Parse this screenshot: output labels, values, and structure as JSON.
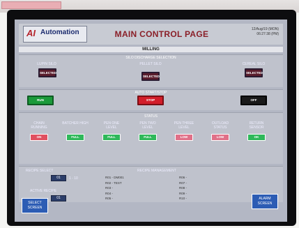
{
  "sticker_text": "",
  "header": {
    "logo_mark": "AI",
    "logo_name": "Automation",
    "logo_tag": "",
    "title": "MAIN CONTROL PAGE",
    "date": "12/Aug/19 (MON)",
    "time": "06:27:38 (PM)"
  },
  "subtitle": "MILLING",
  "silo_section": {
    "title": "SILO DISCHARGE SELECTION",
    "lupin_label": "LUPIN SILO",
    "pellet_label": "PELLET SILO",
    "cereal_label": "CEREAL SILO",
    "button_text": "SELECTED"
  },
  "auto_section": {
    "title": "AUTO START/STOP",
    "run": "RUN",
    "stop": "STOP",
    "off": "OFF"
  },
  "status_section": {
    "title": "STATUS",
    "items": [
      {
        "label": "CHAIN RUNNING",
        "value": "ON",
        "color": "#e05060"
      },
      {
        "label": "BATCHER HIGH",
        "value": "FULL",
        "color": "#2fb85a"
      },
      {
        "label": "PEN ONE LEVEL",
        "value": "FULL",
        "color": "#2fb85a"
      },
      {
        "label": "PEN TWO LEVEL",
        "value": "FULL",
        "color": "#2fb85a"
      },
      {
        "label": "PEN THREE LEVEL",
        "value": "LOW",
        "color": "#e07088"
      },
      {
        "label": "OUTLOAD STATUS",
        "value": "LOW",
        "color": "#e07088"
      },
      {
        "label": "RETURN SENSOR",
        "value": "OK",
        "color": "#2fb85a"
      }
    ]
  },
  "recipe": {
    "select_label": "RECIPE SELECT",
    "select_value": "01",
    "range": "1 - 10",
    "active_label": "ACTIVE RECIPE",
    "active_value": "01",
    "management_title": "RECIPE MANAGEMENT",
    "list_left": [
      "R01 - DM001",
      "R02 - TEST",
      "R03 -",
      "R04 -",
      "R05 -"
    ],
    "list_right": [
      "R06 -",
      "R07 -",
      "R08 -",
      "R09 -",
      "R10 -"
    ]
  },
  "nav": {
    "select_screen": "SELECT SCREEN",
    "alarm_screen": "ALARM SCREEN"
  }
}
